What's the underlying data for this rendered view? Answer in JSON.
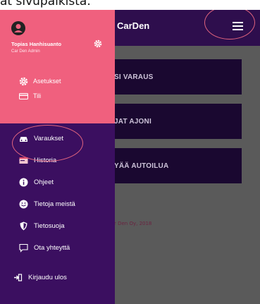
{
  "caption": "ät sivupalkista.",
  "header": {
    "brand": "CarDen"
  },
  "main": {
    "cards": [
      {
        "label": "SI VARAUS"
      },
      {
        "label": "JAT AJONI"
      },
      {
        "label": "YÄÄ AUTOILUA"
      }
    ],
    "footer": "r Den Oy, 2018"
  },
  "drawer": {
    "profile": {
      "name": "Topias Hanhisuanto",
      "role": "Car Den Admin"
    },
    "profile_items": [
      {
        "label": "Asetukset",
        "icon": "gear-icon"
      },
      {
        "label": "Tili",
        "icon": "credit-card-icon"
      }
    ],
    "nav_items": [
      {
        "label": "Varaukset",
        "icon": "car-icon"
      },
      {
        "label": "Historia",
        "icon": "history-card-icon"
      },
      {
        "label": "Ohjeet",
        "icon": "info-icon"
      },
      {
        "label": "Tietoja meistä",
        "icon": "smile-icon"
      },
      {
        "label": "Tietosuoja",
        "icon": "shield-icon"
      },
      {
        "label": "Ota yhteyttä",
        "icon": "chat-icon"
      }
    ],
    "logout": {
      "label": "Kirjaudu ulos",
      "icon": "sign-out-icon"
    }
  },
  "colors": {
    "profile_bg": "#f0607e",
    "drawer_bg": "#3b0f60",
    "topbar_bg": "#2e0e4d",
    "highlight": "#e0637e"
  }
}
